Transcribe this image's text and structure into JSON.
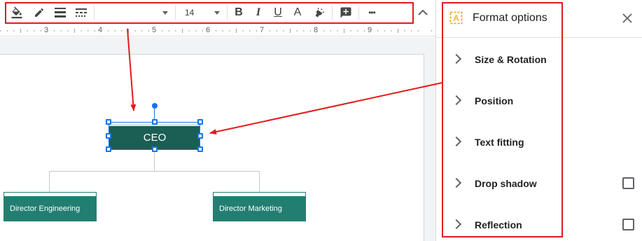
{
  "toolbar": {
    "font_name": "",
    "font_size": "14",
    "bold_label": "B",
    "italic_label": "I",
    "underline_label": "U",
    "text_color_label": "A",
    "more_label": "•••"
  },
  "ruler": {
    "numbers": [
      "3",
      "4",
      "5",
      "6",
      "7",
      "8",
      "9"
    ]
  },
  "org_chart": {
    "root": "CEO",
    "children": [
      "Director Engineering",
      "Director Marketing"
    ]
  },
  "panel": {
    "title": "Format options",
    "items": [
      {
        "label": "Size & Rotation",
        "checkbox": false
      },
      {
        "label": "Position",
        "checkbox": false
      },
      {
        "label": "Text fitting",
        "checkbox": false
      },
      {
        "label": "Drop shadow",
        "checkbox": true
      },
      {
        "label": "Reflection",
        "checkbox": true
      }
    ]
  },
  "colors": {
    "node_dark": "#1b5e53",
    "node_teal": "#237e72",
    "annotation": "#e21b1b",
    "selection": "#1a73e8",
    "panel_icon": "#f29900"
  },
  "icons": [
    "paint-bucket-icon",
    "pencil-icon",
    "line-weight-icon",
    "line-dash-icon",
    "highlighter-icon",
    "add-comment-icon",
    "collapse-icon",
    "format-text-icon",
    "close-icon",
    "chevron-right-icon"
  ]
}
